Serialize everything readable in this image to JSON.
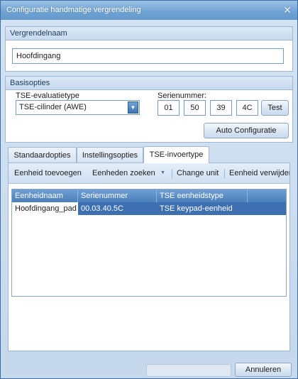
{
  "window": {
    "title": "Configuratie handmatige vergrendeling",
    "close_glyph": "✕"
  },
  "lock_name": {
    "header": "Vergrendelnaam",
    "value": "Hoofdingang"
  },
  "basic": {
    "header": "Basisopties",
    "eval_type_label": "TSE-evaluatietype",
    "eval_type_value": "TSE-cilinder (AWE)",
    "serial_label": "Serienummer:",
    "serial_parts": [
      "01",
      "50",
      "39",
      "4C"
    ],
    "test_button": "Test",
    "auto_config_button": "Auto Configuratie"
  },
  "tabs": [
    {
      "label": "Standaardopties",
      "active": false
    },
    {
      "label": "Instellingsopties",
      "active": false
    },
    {
      "label": "TSE-invoertype",
      "active": true
    }
  ],
  "toolbar": {
    "add_unit": "Eenheid toevoegen",
    "search_units": "Eenheden zoeken",
    "change_unit": "Change unit",
    "remove_unit": "Eenheid verwijderen"
  },
  "grid": {
    "columns": [
      "Eenheidnaam",
      "Serienummer",
      "TSE eenheidstype"
    ],
    "rows": [
      {
        "name": "Hoofdingang_pad",
        "serial": "00.03.40.5C",
        "type": "TSE keypad-eenheid"
      }
    ]
  },
  "footer": {
    "cancel_button": "Annuleren"
  },
  "colors": {
    "title_bar": "#6ea2d3",
    "grid_header": "#4b7fba",
    "selection": "#3e6fb0"
  }
}
